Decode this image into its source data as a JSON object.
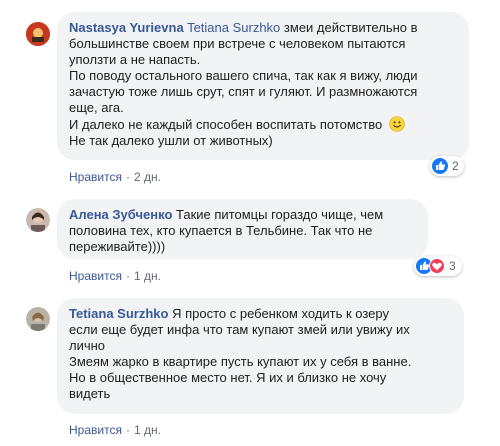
{
  "comments": [
    {
      "author": "Nastasya Yurievna",
      "mention": "Tetiana Surzhko",
      "lines": [
        "змеи действительно в",
        "большинстве своем при встрече с человеком пытаются",
        "уползти а не напасть.",
        "По поводу остального вашего спича, так как я вижу, люди",
        "зачастую тоже лишь срут, спят и гуляют. И размножаются",
        "еще, ага.",
        "И далеко не каждый способен воспитать потомство",
        "Не так далеко ушли от животных)"
      ],
      "emoji": "smile-emoji",
      "like_label": "Нравится",
      "time": "2 дн.",
      "reaction_count": "2",
      "reactions": [
        "like-icon"
      ]
    },
    {
      "author": "Алена Зубченко",
      "lines": [
        "Такие питомцы гораздо чище, чем",
        "половина тех, кто купается в Тельбине. Так что не",
        "переживайте))))"
      ],
      "like_label": "Нравится",
      "time": "1 дн.",
      "reaction_count": "3",
      "reactions": [
        "like-icon",
        "love-icon"
      ]
    },
    {
      "author": "Tetiana Surzhko",
      "lines": [
        "Я просто с ребенком ходить к озеру",
        "если еще будет инфа что там купают змей или увижу их",
        "лично",
        "Змеям жарко в квартире пусть купают их у себя в ванне.",
        "Но в общественное место нет. Я их и близко не хочу",
        "видеть"
      ],
      "like_label": "Нравится",
      "time": "1 дн."
    }
  ],
  "colors": {
    "bubble": "#f2f3f5",
    "link": "#385898",
    "meta": "#606770",
    "like_blue": "#1877f2",
    "love_red": "#f33e58"
  }
}
